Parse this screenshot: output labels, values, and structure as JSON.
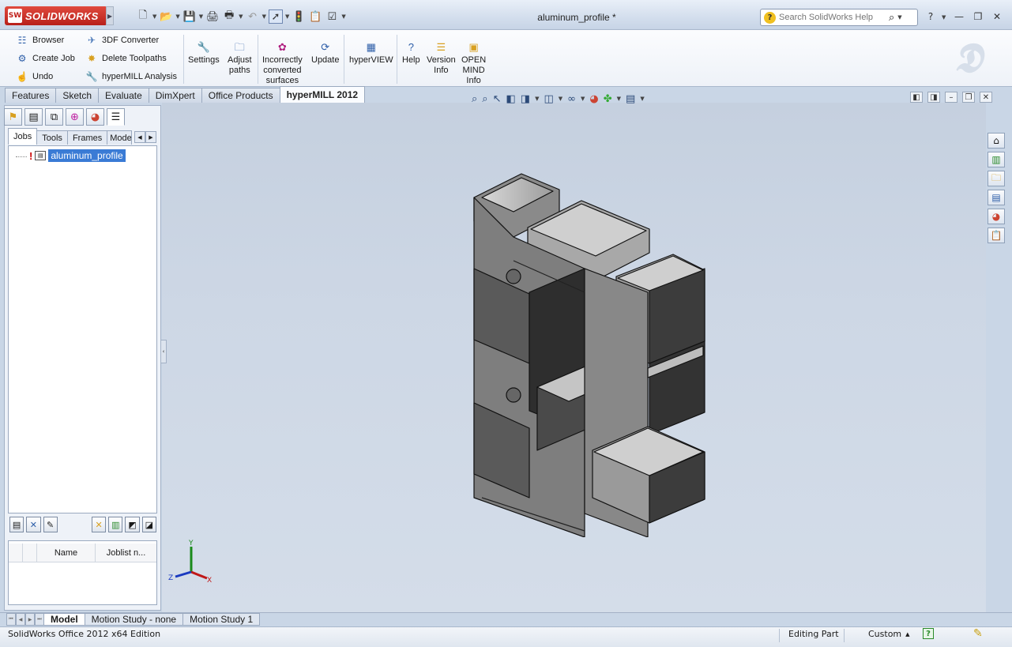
{
  "app": {
    "brand": "SOLIDWORKS",
    "logo_badge": "SW",
    "doc_title": "aluminum_profile *"
  },
  "search": {
    "placeholder": "Search SolidWorks Help"
  },
  "command_manager": {
    "col1": [
      "Browser",
      "Create Job",
      "Undo"
    ],
    "col2": [
      "3DF Converter",
      "Delete Toolpaths",
      "hyperMILL Analysis"
    ],
    "big": [
      {
        "label": "Settings"
      },
      {
        "label": "Adjust\npaths"
      },
      {
        "label": "Incorrectly\nconverted\nsurfaces"
      },
      {
        "label": "Update"
      },
      {
        "label": "hyperVIEW"
      },
      {
        "label": "Help"
      },
      {
        "label": "Version\nInfo"
      },
      {
        "label": "OPEN\nMIND\nInfo"
      }
    ]
  },
  "tabs": [
    "Features",
    "Sketch",
    "Evaluate",
    "DimXpert",
    "Office Products",
    "hyperMILL 2012"
  ],
  "left_panel": {
    "subtabs": [
      "Jobs",
      "Tools",
      "Frames",
      "Mode"
    ],
    "tree_item": "aluminum_profile",
    "joblist_columns": [
      "Name",
      "Joblist n..."
    ]
  },
  "triad": {
    "x": "X",
    "y": "Y",
    "z": "Z"
  },
  "bottom_tabs": [
    "Model",
    "Motion Study - none",
    "Motion Study 1"
  ],
  "status": {
    "edition": "SolidWorks Office 2012 x64 Edition",
    "mode": "Editing Part",
    "units": "Custom",
    "units_arrow": "▲",
    "help_badge": "?"
  },
  "colors": {
    "accent": "#3a7bd5",
    "brand_red": "#c0201a",
    "viewport": "#cdd7e5"
  }
}
